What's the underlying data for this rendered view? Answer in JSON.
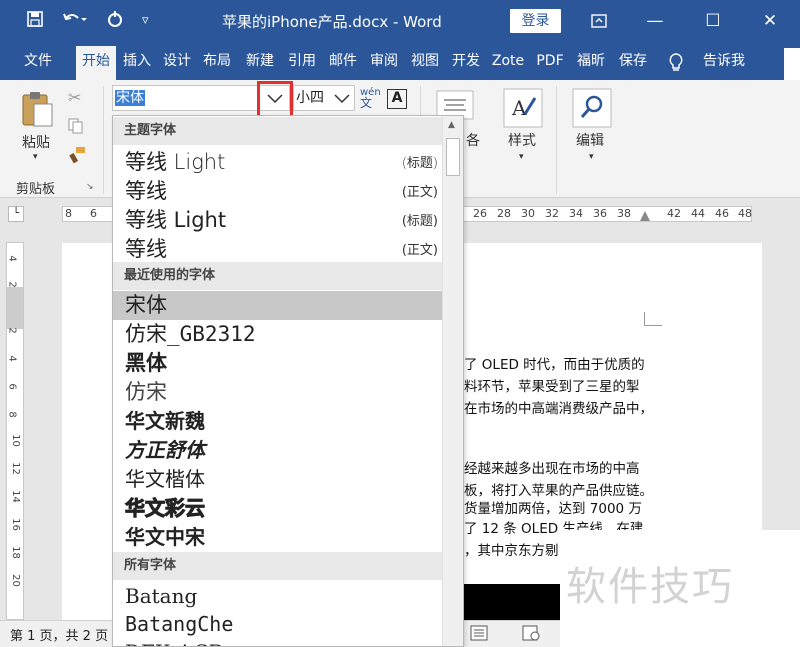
{
  "window": {
    "title": "苹果的iPhone产品.docx - Word",
    "login_label": "登录"
  },
  "tabs": [
    "文件",
    "开始",
    "插入",
    "设计",
    "布局",
    "新建",
    "引用",
    "邮件",
    "审阅",
    "视图",
    "开发",
    "Zote",
    "PDF",
    "福昕",
    "保存",
    "告诉我"
  ],
  "ribbon": {
    "paste_label": "粘贴",
    "clipboard_label": "剪贴板",
    "font_name": "宋体",
    "font_size": "小四",
    "style_label": "样式",
    "edit_label": "编辑",
    "partial_label": "各"
  },
  "ruler": {
    "left_numbers": [
      "8",
      "6"
    ],
    "right_numbers": [
      "26",
      "28",
      "30",
      "32",
      "34",
      "36",
      "38",
      "42",
      "44",
      "46",
      "48"
    ],
    "vertical_numbers": [
      "4",
      "2",
      "2",
      "4",
      "6",
      "8",
      "10",
      "12",
      "14",
      "16",
      "18",
      "20"
    ]
  },
  "font_dropdown": {
    "section_theme": "主题字体",
    "theme_fonts": [
      {
        "name": "等线 Light",
        "tag": "(标题)"
      },
      {
        "name": "等线",
        "tag": "(正文)"
      },
      {
        "name": "等线 Light",
        "tag": "(标题)"
      },
      {
        "name": "等线",
        "tag": "(正文)"
      }
    ],
    "section_recent": "最近使用的字体",
    "recent_fonts": [
      "宋体",
      "仿宋_GB2312",
      "黑体",
      "仿宋",
      "华文新魏",
      "方正舒体",
      "华文楷体",
      "华文彩云",
      "华文中宋"
    ],
    "section_all": "所有字体",
    "all_fonts": [
      "Batang",
      "BatangChe",
      "DFKai-SB"
    ]
  },
  "document": {
    "lines": [
      "了 OLED 时代，而由于优质的",
      "料环节，苹果受到了三星的掣",
      "在市场的中高端消费级产品中，",
      "经越来越多出现在市场的中高",
      "板，将打入苹果的产品供应链。",
      "货量增加两倍，达到 7000 万",
      "了 12 条 OLED 生产线，在建",
      "，其中京东方剔"
    ]
  },
  "status": {
    "page_info": "第 1 页，共 2 页"
  },
  "watermark": "软件技巧"
}
